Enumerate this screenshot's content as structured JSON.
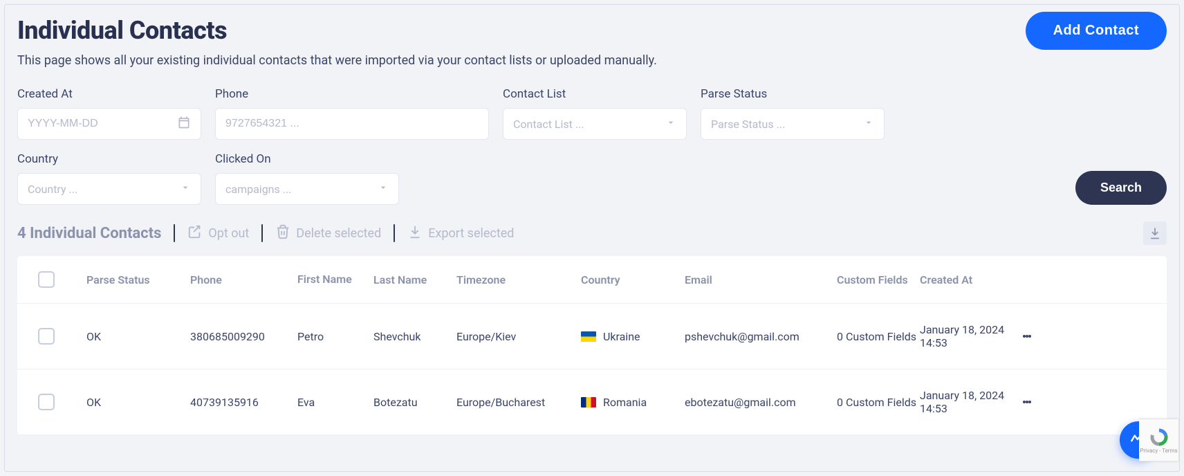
{
  "header": {
    "title": "Individual Contacts",
    "subtitle": "This page shows all your existing individual contacts that were imported via your contact lists or uploaded manually.",
    "add_button": "Add Contact"
  },
  "filters": {
    "created_at": {
      "label": "Created At",
      "placeholder": "YYYY-MM-DD"
    },
    "phone": {
      "label": "Phone",
      "placeholder": "9727654321 ..."
    },
    "contact_list": {
      "label": "Contact List",
      "placeholder": "Contact List ..."
    },
    "parse_status": {
      "label": "Parse Status",
      "placeholder": "Parse Status ..."
    },
    "country": {
      "label": "Country",
      "placeholder": "Country ..."
    },
    "clicked_on": {
      "label": "Clicked On",
      "placeholder": "campaigns ..."
    },
    "search_button": "Search"
  },
  "actions": {
    "count_label": "4 Individual Contacts",
    "opt_out": "Opt out",
    "delete_selected": "Delete selected",
    "export_selected": "Export selected"
  },
  "table": {
    "headers": {
      "parse_status": "Parse Status",
      "phone": "Phone",
      "first_name": "First Name",
      "last_name": "Last Name",
      "timezone": "Timezone",
      "country": "Country",
      "email": "Email",
      "custom_fields": "Custom Fields",
      "created_at": "Created At"
    },
    "rows": [
      {
        "parse_status": "OK",
        "phone": "380685009290",
        "first_name": "Petro",
        "last_name": "Shevchuk",
        "timezone": "Europe/Kiev",
        "country": "Ukraine",
        "flag": "ua",
        "email": "pshevchuk@gmail.com",
        "custom_fields": "0 Custom Fields",
        "created_at": "January 18, 2024 14:53"
      },
      {
        "parse_status": "OK",
        "phone": "40739135916",
        "first_name": "Eva",
        "last_name": "Botezatu",
        "timezone": "Europe/Bucharest",
        "country": "Romania",
        "flag": "ro",
        "email": "ebotezatu@gmail.com",
        "custom_fields": "0 Custom Fields",
        "created_at": "January 18, 2024 14:53"
      }
    ]
  },
  "recaptcha": {
    "text": "Privacy - Terms"
  }
}
